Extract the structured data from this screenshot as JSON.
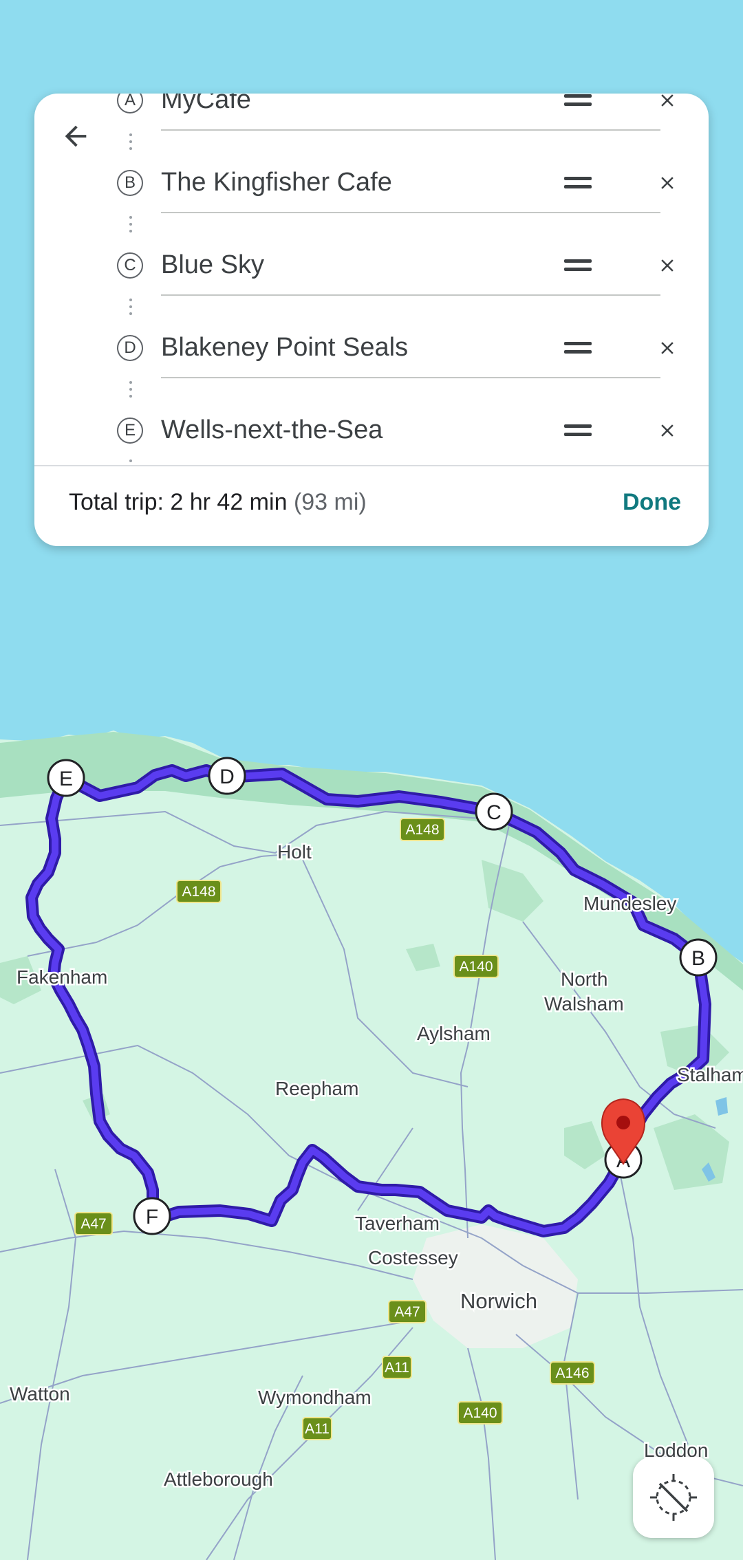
{
  "stops": [
    {
      "letter": "A",
      "name": "MyCafe"
    },
    {
      "letter": "B",
      "name": "The Kingfisher Cafe"
    },
    {
      "letter": "C",
      "name": "Blue Sky"
    },
    {
      "letter": "D",
      "name": "Blakeney Point Seals"
    },
    {
      "letter": "E",
      "name": "Wells-next-the-Sea"
    }
  ],
  "summary": {
    "label": "Total trip: 2 hr 42 min",
    "distance": "(93 mi)",
    "done_label": "Done"
  },
  "map": {
    "places": {
      "holt": "Holt",
      "mundesley": "Mundesley",
      "fakenham": "Fakenham",
      "north": "North",
      "walsham": "Walsham",
      "aylsham": "Aylsham",
      "reepham": "Reepham",
      "stalham": "Stalham",
      "taverham": "Taverham",
      "costessey": "Costessey",
      "norwich": "Norwich",
      "watton": "Watton",
      "wymondham": "Wymondham",
      "attleborough": "Attleborough",
      "loddon": "Loddon"
    },
    "roads": {
      "a148_1": "A148",
      "a148_2": "A148",
      "a140_1": "A140",
      "a47_1": "A47",
      "a47_2": "A47",
      "a11_1": "A11",
      "a146": "A146",
      "a140_2": "A140",
      "a11_2": "A11"
    },
    "markers": {
      "a": "A",
      "b": "B",
      "c": "C",
      "d": "D",
      "e": "E",
      "f": "F"
    },
    "colors": {
      "sea": "#8fdcef",
      "land": "#d4f5e4",
      "route": "#5a3cf0",
      "route_outline": "#2f1ba8",
      "pin": "#ea4335",
      "road_shield": "#6a8f1a",
      "accent": "#10797f"
    }
  },
  "icons": {
    "back": "back-arrow-icon",
    "drag": "drag-handle-icon",
    "close": "close-icon",
    "gps": "location-disabled-icon",
    "pin": "location-pin-icon"
  }
}
